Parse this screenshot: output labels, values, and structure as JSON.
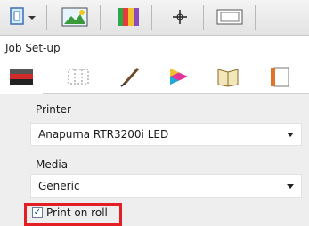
{
  "toolbar": {
    "icons": [
      "job-setup-icon",
      "image-icon",
      "color-palette-icon",
      "crosshair-icon",
      "layout-icon"
    ]
  },
  "section": {
    "title": "Job Set-up"
  },
  "tabs": [
    "printer-tab-icon",
    "grid-tab-icon",
    "pen-tab-icon",
    "color-tab-icon",
    "book-tab-icon",
    "document-tab-icon"
  ],
  "printer": {
    "label": "Printer",
    "value": "Anapurna RTR3200i LED"
  },
  "media": {
    "label": "Media",
    "value": "Generic"
  },
  "print_on_roll": {
    "label": "Print on roll",
    "checked": true
  },
  "colors": {
    "accent": "#e41e25"
  }
}
